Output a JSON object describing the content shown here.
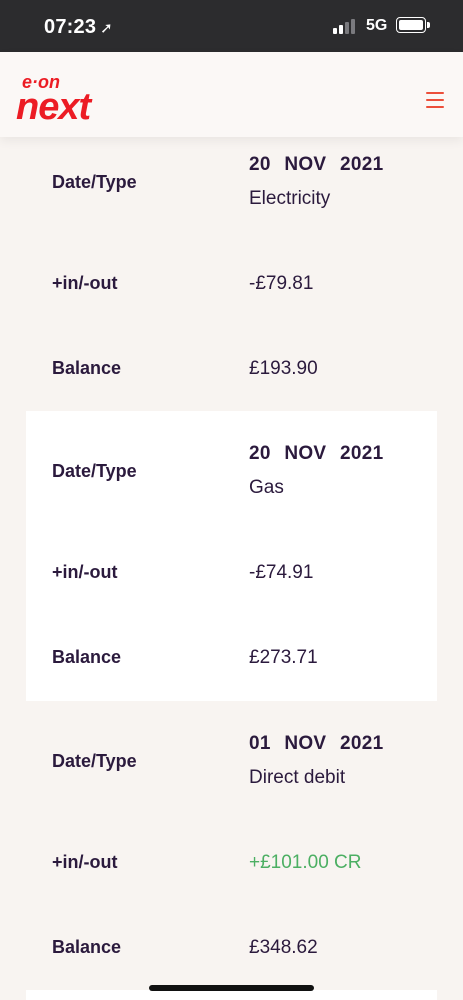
{
  "status_bar": {
    "time": "07:23",
    "network": "5G"
  },
  "header": {
    "logo_top": "e·on",
    "logo_bottom": "next",
    "menu_icon": "hamburger-icon",
    "brand_color": "#ec1c24"
  },
  "labels": {
    "date_type": "Date/Type",
    "in_out": "+in/-out",
    "balance": "Balance"
  },
  "transactions": [
    {
      "date": "20 NOV 2021",
      "type": "Electricity",
      "amount": "-£79.81",
      "balance": "£193.90",
      "highlight": false
    },
    {
      "date": "20 NOV 2021",
      "type": "Gas",
      "amount": "-£74.91",
      "balance": "£273.71",
      "highlight": true
    },
    {
      "date": "01 NOV 2021",
      "type": "Direct debit",
      "amount": "+£101.00 CR",
      "balance": "£348.62",
      "highlight": false
    }
  ],
  "colors": {
    "credit": "#4caf63",
    "text": "#2b1a3d",
    "accent": "#ec4f3b"
  }
}
